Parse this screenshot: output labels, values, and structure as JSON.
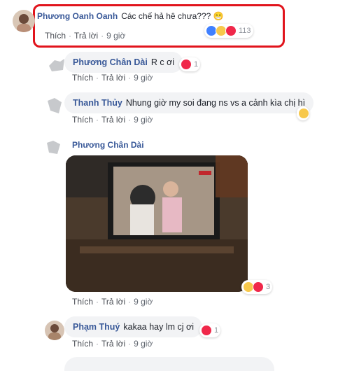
{
  "comments": [
    {
      "author": "Phương Oanh Oanh",
      "text": "Các chế hả hê chưa???",
      "emoji": "😁",
      "like": "Thích",
      "reply": "Trả lời",
      "time": "9 giờ",
      "reactions": "113"
    },
    {
      "author": "Phương Chân Dài",
      "text": "R c ơi",
      "like": "Thích",
      "reply": "Trả lời",
      "time": "9 giờ",
      "reactions": "1"
    },
    {
      "author": "Thanh Thủy",
      "text": "Nhung giờ my soi đang ns vs a cảnh kìa chị hì",
      "like": "Thích",
      "reply": "Trả lời",
      "time": "9 giờ",
      "reactions": ""
    },
    {
      "author": "Phương Chân Dài",
      "like": "Thích",
      "reply": "Trả lời",
      "time": "9 giờ",
      "reactions": "3"
    },
    {
      "author": "Phạm Thuý",
      "text": "kakaa hay lm cj ơi",
      "like": "Thích",
      "reply": "Trả lời",
      "time": "9 giờ",
      "reactions": "1"
    }
  ],
  "colors": {
    "highlight": "#e1141c",
    "link": "#385898"
  }
}
